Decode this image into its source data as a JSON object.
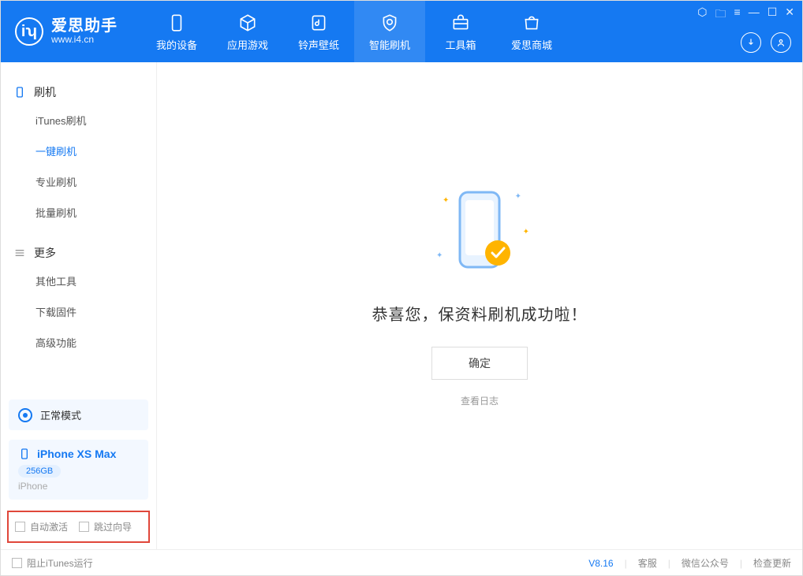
{
  "app": {
    "name": "爱思助手",
    "site": "www.i4.cn"
  },
  "tabs": [
    {
      "label": "我的设备"
    },
    {
      "label": "应用游戏"
    },
    {
      "label": "铃声壁纸"
    },
    {
      "label": "智能刷机"
    },
    {
      "label": "工具箱"
    },
    {
      "label": "爱思商城"
    }
  ],
  "sidebar": {
    "group1": {
      "title": "刷机",
      "items": [
        "iTunes刷机",
        "一键刷机",
        "专业刷机",
        "批量刷机"
      ]
    },
    "group2": {
      "title": "更多",
      "items": [
        "其他工具",
        "下载固件",
        "高级功能"
      ]
    }
  },
  "mode": {
    "label": "正常模式"
  },
  "device": {
    "name": "iPhone XS Max",
    "storage": "256GB",
    "type": "iPhone"
  },
  "options": {
    "auto_activate": "自动激活",
    "skip_guide": "跳过向导"
  },
  "result": {
    "message": "恭喜您，保资料刷机成功啦！",
    "ok": "确定",
    "log": "查看日志"
  },
  "footer": {
    "block_itunes": "阻止iTunes运行",
    "version": "V8.16",
    "support": "客服",
    "wechat": "微信公众号",
    "update": "检查更新"
  }
}
